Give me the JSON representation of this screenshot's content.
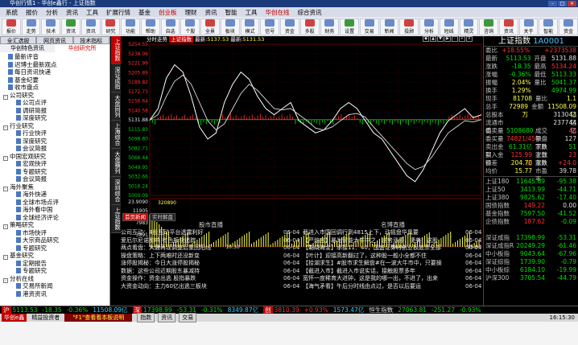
{
  "window": {
    "title": "华创行情1 - 华创e鑫行 - 上证指数"
  },
  "menu": [
    "系统",
    "报价",
    "分析",
    "资讯",
    "工具",
    "扩展行情",
    "基金",
    "创业板",
    "理财",
    "资讯",
    "智能",
    "工具",
    "华创在线",
    "综合资讯"
  ],
  "menu_highlight": [
    7,
    12
  ],
  "toolbar": [
    "报价",
    "走势",
    "技术",
    "资讯",
    "资讯",
    "研究",
    "功能",
    "帮助",
    "自选",
    "个股",
    "全景",
    "板块",
    "模式",
    "信号",
    "资金",
    "多股",
    "财务",
    "设置",
    "交易",
    "新闻",
    "投顾",
    "分析",
    "短线",
    "精灵",
    "咨询",
    "资讯",
    "关于",
    "智能",
    "资金"
  ],
  "leftpanel": {
    "tabs": [
      "全汇选股",
      "网页资讯",
      "技术指标"
    ],
    "subtabs": [
      "华创特色资讯",
      "华创研究所"
    ],
    "tree": [
      {
        "label": "最新评音",
        "level": 1,
        "type": "doc"
      },
      {
        "label": "迟博士最新观点",
        "level": 1,
        "type": "doc"
      },
      {
        "label": "每日资讯快递",
        "level": 1,
        "type": "doc"
      },
      {
        "label": "基金纪要",
        "level": 1,
        "type": "doc"
      },
      {
        "label": "收市盘点",
        "level": 1,
        "type": "doc"
      },
      {
        "label": "公司研究",
        "level": 0,
        "type": "folder"
      },
      {
        "label": "公司点评",
        "level": 2,
        "type": "doc"
      },
      {
        "label": "调研简报",
        "level": 2,
        "type": "doc"
      },
      {
        "label": "深度研究",
        "level": 2,
        "type": "doc"
      },
      {
        "label": "行业研究",
        "level": 0,
        "type": "folder"
      },
      {
        "label": "行业快评",
        "level": 2,
        "type": "doc"
      },
      {
        "label": "深度研究",
        "level": 2,
        "type": "doc"
      },
      {
        "label": "会议简报",
        "level": 2,
        "type": "doc"
      },
      {
        "label": "中国宏观研究",
        "level": 0,
        "type": "folder"
      },
      {
        "label": "宏观快评",
        "level": 2,
        "type": "doc"
      },
      {
        "label": "专题研究",
        "level": 2,
        "type": "doc"
      },
      {
        "label": "会议简报",
        "level": 2,
        "type": "doc"
      },
      {
        "label": "海外聚焦",
        "level": 0,
        "type": "folder"
      },
      {
        "label": "海外快递",
        "level": 2,
        "type": "doc"
      },
      {
        "label": "全球市场点评",
        "level": 2,
        "type": "doc"
      },
      {
        "label": "海外看中国",
        "level": 2,
        "type": "doc"
      },
      {
        "label": "全球经济评论",
        "level": 2,
        "type": "doc"
      },
      {
        "label": "策略研究",
        "level": 0,
        "type": "folder"
      },
      {
        "label": "市场快评",
        "level": 2,
        "type": "doc"
      },
      {
        "label": "大宗商品研究",
        "level": 2,
        "type": "doc"
      },
      {
        "label": "专题研究",
        "level": 2,
        "type": "doc"
      },
      {
        "label": "基金研究",
        "level": 0,
        "type": "folder"
      },
      {
        "label": "定期报告",
        "level": 2,
        "type": "doc"
      },
      {
        "label": "专题研究",
        "level": 2,
        "type": "doc"
      },
      {
        "label": "分析在线",
        "level": 0,
        "type": "folder"
      },
      {
        "label": "交易所新闻",
        "level": 2,
        "type": "doc"
      },
      {
        "label": "港资资讯",
        "level": 2,
        "type": "doc"
      }
    ]
  },
  "vtabs": [
    "上证指数",
    "深证成指",
    "大盘同列",
    "上海综合",
    "大盘横列",
    "深圳综合",
    "上证指数"
  ],
  "chart_header": {
    "period": "分时走势",
    "index": "上证指数",
    "latest_label": "最新:",
    "latest": "5137.53",
    "mean_label": "最新:",
    "mean": "5131.53"
  },
  "chart_controls": [
    "◆",
    "▲",
    "▼",
    "▶",
    "-",
    "+",
    "X"
  ],
  "chart_data": {
    "type": "line",
    "ylim": [
      5007.48,
      5255.66
    ],
    "y_ticks": [
      "5254.55",
      "5238.06",
      "5221.99",
      "5205.89",
      "5189.82",
      "5172.73",
      "5156.64",
      "5140.58",
      "5131.88",
      "5115.83",
      "5098.80",
      "5082.71",
      "5066.44",
      "5049.95",
      "5032.66",
      "5016.24",
      "5000.09"
    ],
    "x_labels": [
      "9:30",
      "10:30",
      "11:30",
      "14:00",
      "15:00"
    ],
    "prev_close": 5131.88,
    "vol_label": "23.9090",
    "vol_ticks": [
      "11905",
      "7983",
      "3891"
    ],
    "vol_value": "320890",
    "series": [
      {
        "values": [
          5131,
          5150,
          5200,
          5222,
          5210,
          5170,
          5120,
          5100,
          5110,
          5160,
          5190,
          5210,
          5198,
          5170,
          5150,
          5140,
          5150,
          5160,
          5130,
          5120,
          5110,
          5115,
          5130,
          5150,
          5160,
          5150,
          5130,
          5110,
          5100,
          5080,
          5060,
          5040,
          5030,
          5050,
          5080,
          5110,
          5130,
          5140,
          5150,
          5135,
          5140
        ]
      },
      {
        "values": [
          5131,
          5140,
          5170,
          5195,
          5205,
          5190,
          5160,
          5130,
          5115,
          5125,
          5150,
          5175,
          5190,
          5180,
          5165,
          5150,
          5148,
          5150,
          5140,
          5130,
          5118,
          5115,
          5120,
          5130,
          5140,
          5142,
          5136,
          5120,
          5105,
          5090,
          5075,
          5060,
          5050,
          5055,
          5070,
          5090,
          5110,
          5120,
          5130,
          5128,
          5132
        ]
      }
    ]
  },
  "rightpanel": {
    "title": "上证指数",
    "code": "1A0001",
    "rows": [
      {
        "l": "委比",
        "v": "+18.55%",
        "vc": "red",
        "l2": "",
        "v2": "+2373538",
        "v2c": "red"
      },
      {
        "l": "最新",
        "v": "5113.53",
        "vc": "grn",
        "l2": "开盘",
        "v2": "5131.88",
        "v2c": "wht"
      },
      {
        "l": "涨跌",
        "v": "-18.35",
        "vc": "grn",
        "l2": "最高",
        "v2": "5134.24",
        "v2c": "red"
      },
      {
        "l": "涨幅",
        "v": "-0.36%",
        "vc": "grn",
        "l2": "最低",
        "v2": "5113.33",
        "v2c": "grn"
      },
      {
        "l": "振幅",
        "v": "2.04%",
        "vc": "ylw",
        "l2": "量比",
        "v2": "5041.37",
        "v2c": "grn"
      },
      {
        "l": "换手",
        "v": "1.29%",
        "vc": "ylw",
        "l2": "",
        "v2": "4974.99",
        "v2c": "grn"
      },
      {
        "l": "现手",
        "v": "81708",
        "vc": "ylw",
        "l2": "量比",
        "v2": "1.1",
        "v2c": "ylw"
      },
      {
        "l": "总手",
        "v": "72989万",
        "vc": "ylw",
        "l2": "金额",
        "v2": "11508.09亿",
        "v2c": "ylw"
      },
      {
        "l": "总股本",
        "v": "",
        "vc": "wht",
        "l2": "",
        "v2": "313043亿",
        "v2c": "wht"
      },
      {
        "l": "流通市值",
        "v": "",
        "vc": "wht",
        "l2": "",
        "v2": "237744亿",
        "v2c": "wht"
      },
      {
        "l": "委卖量",
        "v": "5108680",
        "vc": "grn",
        "l2": "成交额",
        "v2": "45",
        "v2c": "red"
      },
      {
        "l": "委买量",
        "v": "74821/45",
        "vc": "red",
        "l2": "平盘家数",
        "v2": "127",
        "v2c": "wht"
      },
      {
        "l": "卖出金额",
        "v": "61.31亿",
        "vc": "grn",
        "l2": "下跌家数",
        "v2": "51",
        "v2c": "grn"
      },
      {
        "l": "买入金额",
        "v": "125.99亿",
        "vc": "red",
        "l2": "上涨家数",
        "v2": "23",
        "v2c": "red"
      },
      {
        "l": "价差",
        "v": "204.70",
        "vc": "ylw",
        "l2": "涨跌",
        "v2": "+24.0",
        "v2c": "red"
      },
      {
        "l": "均价",
        "v": "15.77",
        "vc": "ylw",
        "l2": "市盈率",
        "v2": "39.78",
        "v2c": "wht"
      }
    ],
    "indices": [
      {
        "name": "上证180",
        "a": "11645.69",
        "ac": "grn",
        "b": "-95.38",
        "bc": "grn"
      },
      {
        "name": "上证50",
        "a": "3413.99",
        "ac": "grn",
        "b": "-44.71",
        "bc": "grn"
      },
      {
        "name": "上证380",
        "a": "9825.62",
        "ac": "grn",
        "b": "-17.40",
        "bc": "grn"
      },
      {
        "name": "国债指数",
        "a": "149.22",
        "ac": "red",
        "b": "0.00",
        "bc": "wht"
      },
      {
        "name": "基金指数",
        "a": "7597.50",
        "ac": "grn",
        "b": "-41.52",
        "bc": "grn"
      },
      {
        "name": "企债指数",
        "a": "187.62",
        "ac": "red",
        "b": "-0.09",
        "bc": "grn"
      },
      {
        "name": "",
        "a": "",
        "ac": "wht",
        "b": "",
        "bc": "wht"
      },
      {
        "name": "深证成指",
        "a": "17398.99",
        "ac": "grn",
        "b": "-53.31",
        "bc": "grn"
      },
      {
        "name": "深证成指R",
        "a": "20249.29",
        "ac": "grn",
        "b": "-61.46",
        "bc": "grn"
      },
      {
        "name": "中小板指",
        "a": "9043.64",
        "ac": "grn",
        "b": "-67.96",
        "bc": "grn"
      },
      {
        "name": "深证综指",
        "a": "1739.90",
        "ac": "grn",
        "b": "-0.79",
        "bc": "grn"
      },
      {
        "name": "中小板综",
        "a": "6184.10",
        "ac": "grn",
        "b": "-19.99",
        "bc": "grn"
      },
      {
        "name": "沪深300",
        "a": "3705.54",
        "ac": "grn",
        "b": "-44.79",
        "bc": "grn"
      }
    ]
  },
  "news": {
    "tabs": [
      "首页新闻",
      "实时解盘"
    ],
    "left_header": "股市直播",
    "right_header": "名博直播",
    "left": [
      {
        "t": "公司互动：4股互动平台透露利好",
        "d": "06-04"
      },
      {
        "t": "爱厄尔尼诺影响 有色板块追踪",
        "d": "06-04"
      },
      {
        "t": "两点看盘：大盘再现调整后重回阳线",
        "d": "06-04"
      },
      {
        "t": "操盘策略：上下两难时还没新变",
        "d": "06-04"
      },
      {
        "t": "涨停股揭秘：今日大涨停股揭秘",
        "d": "06-04"
      },
      {
        "t": "数据：这些公司近期股东暴减持",
        "d": "06-04"
      },
      {
        "t": "资金操作：资金出逃 股指暴跌",
        "d": "06-04"
      },
      {
        "t": "大资金动向：主力60亿出逃三板块",
        "d": "06-04"
      }
    ],
    "right": [
      {
        "t": "截进入市国回调行到4815上下，动摇盘华具要",
        "d": "06-04"
      },
      {
        "t": "【严焰言】暴为智能大牛中之，逆势涨停，凄美！这股",
        "d": "06-04"
      },
      {
        "t": "【鸵绕海金】承接11：40，国盛证券将创业板股票全部",
        "d": "06-04"
      },
      {
        "t": "【叶计】迎接高新翻过了，这种股一般小全都不住",
        "d": "06-04"
      },
      {
        "t": "【拾湖求生】#股市求生解盘#在一波大牛市中，只要操",
        "d": "06-04"
      },
      {
        "t": "【截进入市】截进入市说实话，接触股票多年",
        "d": "06-04"
      },
      {
        "t": "宽怀一度稀育大进钟，这是我的哪一出，不进了，出来",
        "d": "06-04"
      },
      {
        "t": "【海气矛看】午后分时线由点过，是否以后要运",
        "d": "06-04"
      }
    ]
  },
  "ticker": {
    "items": [
      {
        "t": "沪",
        "c": "badge"
      },
      {
        "t": "5113.53",
        "c": "grn"
      },
      {
        "t": "-18.35",
        "c": "grn"
      },
      {
        "t": "-0.36%",
        "c": "grn"
      },
      {
        "t": "11508.09亿",
        "c": "cyn"
      },
      {
        "t": "深",
        "c": "badge"
      },
      {
        "t": "17398.99",
        "c": "grn"
      },
      {
        "t": "-53.31",
        "c": "grn"
      },
      {
        "t": "-0.31%",
        "c": "grn"
      },
      {
        "t": "8349.87亿",
        "c": "cyn"
      },
      {
        "t": "创",
        "c": "badge"
      },
      {
        "t": "3810.39",
        "c": "red"
      },
      {
        "t": "+0.93%",
        "c": "red"
      },
      {
        "t": "1573.47亿",
        "c": "cyn"
      },
      {
        "t": "恒生指数",
        "c": "wht"
      },
      {
        "t": "27063.81",
        "c": "grn"
      },
      {
        "t": "-251.27",
        "c": "grn"
      },
      {
        "t": "-0.93%",
        "c": "grn"
      }
    ]
  },
  "status": {
    "logo": "华创e鑫",
    "label": "精益投资者",
    "scroll": "\"F1\"查看看本板说明",
    "time": "16:15:30",
    "bottom": [
      "指数",
      "资讯",
      "交易"
    ]
  }
}
